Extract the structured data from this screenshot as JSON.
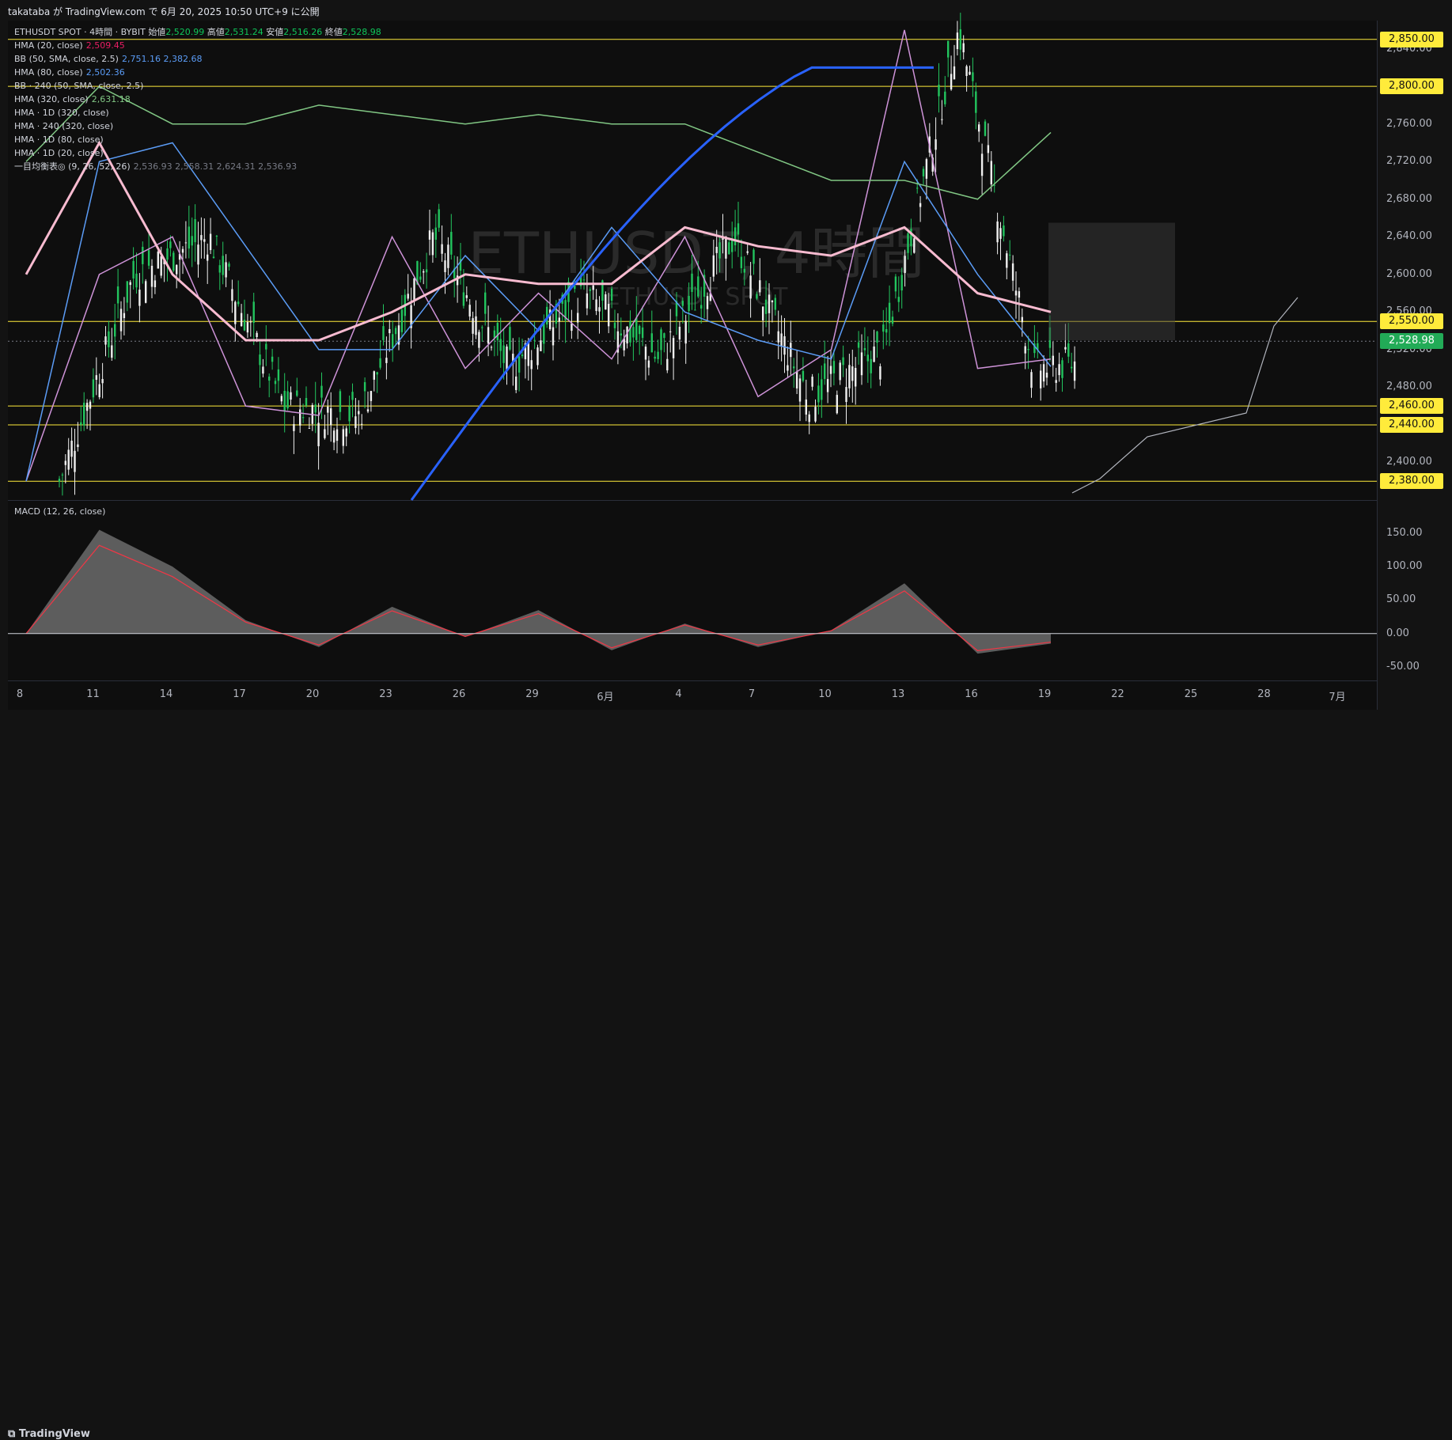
{
  "header": {
    "publish_line": "takataba が TradingView.com で 6月 20, 2025 10:50 UTC+9 に公開"
  },
  "watermark": {
    "main": "ETHUSDT, 4時間",
    "sub": "ETHUSDT SPOT"
  },
  "legend": {
    "title": "ETHUSDT SPOT · 4時間 · BYBIT",
    "ohlc": [
      {
        "label": "始値",
        "value": "2,520.99"
      },
      {
        "label": "高値",
        "value": "2,531.24"
      },
      {
        "label": "安値",
        "value": "2,516.26"
      },
      {
        "label": "終値",
        "value": "2,528.98"
      }
    ],
    "indicators": [
      {
        "name": "HMA (20, close)",
        "values": "2,509.45",
        "color": "#e91e63"
      },
      {
        "name": "BB (50, SMA, close, 2.5)",
        "values": "2,751.16  2,382.68",
        "color": "#5b9cf6"
      },
      {
        "name": "HMA (80, close)",
        "values": "2,502.36",
        "color": "#5b9cf6"
      },
      {
        "name": "BB · 240 (50, SMA, close, 2.5)",
        "values": "",
        "color": "#d1d4dc"
      },
      {
        "name": "HMA (320, close)",
        "values": "2,631.18",
        "color": "#81c784"
      },
      {
        "name": "HMA · 1D (320, close)",
        "values": "",
        "color": "#d1d4dc"
      },
      {
        "name": "HMA · 240 (320, close)",
        "values": "",
        "color": "#d1d4dc"
      },
      {
        "name": "HMA · 1D (80, close)",
        "values": "",
        "color": "#d1d4dc"
      },
      {
        "name": "HMA · 1D (20, close)",
        "values": "",
        "color": "#d1d4dc"
      },
      {
        "name": "一目均衡表◎ (9, 26, 52, 26)",
        "values": "2,536.93  2,558.31  2,624.31  2,536.93",
        "color": "#787b86"
      }
    ]
  },
  "macd_label": "MACD (12, 26, close)",
  "price_axis": {
    "ticks": [
      "2,840.00",
      "2,760.00",
      "2,720.00",
      "2,680.00",
      "2,640.00",
      "2,600.00",
      "2,560.00",
      "2,520.00",
      "2,480.00",
      "2,400.00"
    ],
    "horizontal_lines": [
      "2,850.00",
      "2,800.00",
      "2,550.00",
      "2,460.00",
      "2,440.00",
      "2,380.00"
    ],
    "last_price": "2,528.98",
    "line_color": "#ffeb3b",
    "last_color": "#22ab57"
  },
  "macd_axis": {
    "ticks": [
      "150.00",
      "100.00",
      "50.00",
      "0.00",
      "-50.00"
    ]
  },
  "time_axis": {
    "labels": [
      "8",
      "11",
      "14",
      "17",
      "20",
      "23",
      "26",
      "29",
      "6月",
      "4",
      "7",
      "10",
      "13",
      "16",
      "19",
      "22",
      "25",
      "28",
      "7月"
    ]
  },
  "footer": {
    "brand": "TradingView"
  },
  "chart_data": {
    "type": "line",
    "title": "ETHUSDT SPOT · 4時間 · BYBIT",
    "ylim": [
      2360,
      2870
    ],
    "x": [
      "8",
      "11",
      "14",
      "17",
      "20",
      "23",
      "26",
      "29",
      "6月",
      "4",
      "7",
      "10",
      "13",
      "16",
      "19"
    ],
    "series": [
      {
        "name": "HMA (20, close)",
        "values": [
          2380,
          2600,
          2640,
          2460,
          2450,
          2640,
          2500,
          2580,
          2510,
          2640,
          2470,
          2520,
          2860,
          2500,
          2510
        ]
      },
      {
        "name": "HMA (80, close)",
        "values": [
          2380,
          2720,
          2740,
          2630,
          2520,
          2520,
          2620,
          2540,
          2650,
          2560,
          2530,
          2510,
          2720,
          2600,
          2502
        ]
      },
      {
        "name": "HMA (320, close)",
        "values": [
          2600,
          2740,
          2600,
          2530,
          2530,
          2560,
          2600,
          2590,
          2590,
          2650,
          2630,
          2620,
          2650,
          2580,
          2560
        ]
      },
      {
        "name": "BB (50, SMA, close, 2.5)",
        "values": [
          2720,
          2800,
          2760,
          2760,
          2780,
          2770,
          2760,
          2770,
          2760,
          2760,
          2730,
          2700,
          2700,
          2680,
          2751
        ]
      },
      {
        "name": "MACD (12, 26, close)",
        "values": [
          0,
          155,
          100,
          20,
          -20,
          40,
          -5,
          35,
          -25,
          15,
          -20,
          5,
          75,
          -30,
          -15
        ]
      }
    ]
  }
}
